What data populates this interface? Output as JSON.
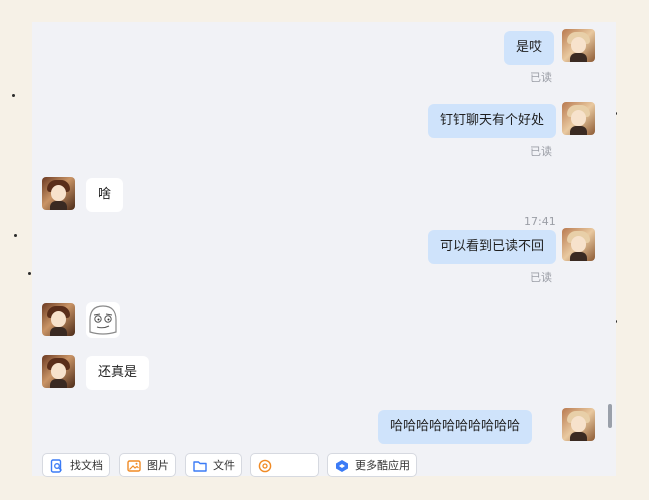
{
  "messages": [
    {
      "side": "out",
      "text": "是哎",
      "read": "已读"
    },
    {
      "side": "out",
      "text": "钉钉聊天有个好处",
      "read": "已读"
    },
    {
      "side": "in",
      "text": "啥"
    },
    {
      "side": "time",
      "text": "17:41"
    },
    {
      "side": "out",
      "text": "可以看到已读不回",
      "read": "已读"
    },
    {
      "side": "in",
      "type": "sticker",
      "sticker": "smirk-face-sticker"
    },
    {
      "side": "in",
      "text": "还真是"
    },
    {
      "side": "out",
      "text": "哈哈哈哈哈哈哈哈哈哈"
    }
  ],
  "toolbar": [
    {
      "label": "找文档",
      "icon": "doc-search-icon",
      "color": "#3b7bf6"
    },
    {
      "label": "图片",
      "icon": "image-icon",
      "color": "#f08a24"
    },
    {
      "label": "文件",
      "icon": "folder-icon",
      "color": "#3b7bf6"
    },
    {
      "label": "",
      "icon": "at-icon",
      "color": "#f08a24"
    },
    {
      "label": "更多酷应用",
      "icon": "apps-icon",
      "color": "#3b7bf6"
    }
  ],
  "colors": {
    "outgoing_bubble": "#cfe3fb",
    "incoming_bubble": "#ffffff",
    "background": "#f1f2f6"
  }
}
